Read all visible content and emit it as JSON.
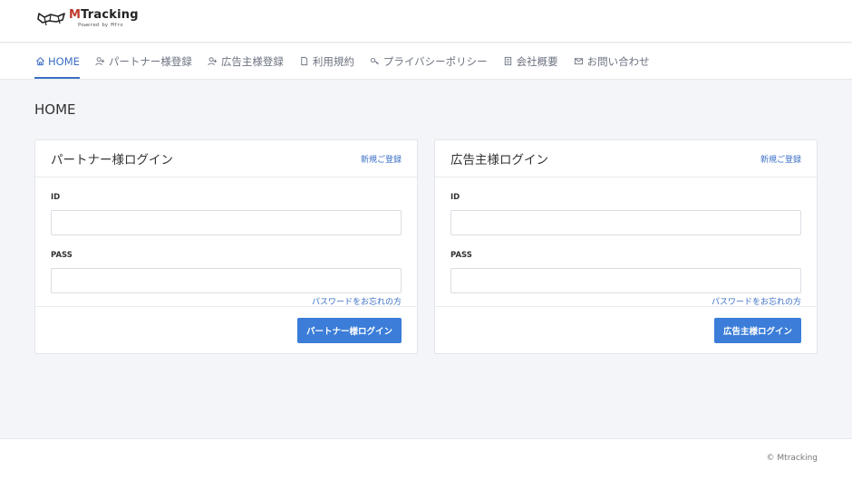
{
  "logo": {
    "main_prefix": "M",
    "main_rest": "Tracking",
    "sub": "Powered by Mfro"
  },
  "nav": {
    "items": [
      {
        "label": "HOME",
        "icon": "home-icon",
        "active": true
      },
      {
        "label": "パートナー様登録",
        "icon": "user-plus-icon",
        "active": false
      },
      {
        "label": "広告主様登録",
        "icon": "user-plus-icon",
        "active": false
      },
      {
        "label": "利用規約",
        "icon": "file-icon",
        "active": false
      },
      {
        "label": "プライバシーポリシー",
        "icon": "key-icon",
        "active": false
      },
      {
        "label": "会社概要",
        "icon": "document-icon",
        "active": false
      },
      {
        "label": "お問い合わせ",
        "icon": "mail-icon",
        "active": false
      }
    ]
  },
  "page": {
    "title": "HOME"
  },
  "partner_card": {
    "title": "パートナー様ログイン",
    "signup_link": "新規ご登録",
    "id_label": "ID",
    "id_value": "",
    "pass_label": "PASS",
    "pass_value": "",
    "forgot_link": "パスワードをお忘れの方",
    "submit_label": "パートナー様ログイン"
  },
  "advertiser_card": {
    "title": "広告主様ログイン",
    "signup_link": "新規ご登録",
    "id_label": "ID",
    "id_value": "",
    "pass_label": "PASS",
    "pass_value": "",
    "forgot_link": "パスワードをお忘れの方",
    "submit_label": "広告主様ログイン"
  },
  "footer": {
    "copyright": "© Mtracking"
  },
  "colors": {
    "accent": "#3b7dd8",
    "link": "#3b6fc4",
    "background": "#f4f5f8",
    "logo_m": "#c0392b"
  }
}
